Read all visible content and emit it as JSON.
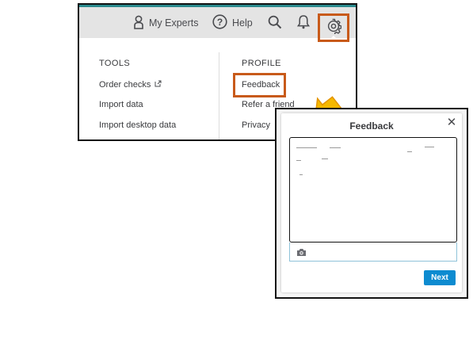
{
  "header": {
    "my_experts_label": "My Experts",
    "help_label": "Help",
    "icons": [
      "person-icon",
      "help-icon",
      "search-icon",
      "bell-icon",
      "gear-icon"
    ]
  },
  "settings_menu": {
    "tools": {
      "title": "TOOLS",
      "items": [
        "Order checks",
        "Import data",
        "Import desktop data"
      ]
    },
    "profile": {
      "title": "PROFILE",
      "items": [
        "Feedback",
        "Refer a friend",
        "Privacy"
      ]
    }
  },
  "feedback_dialog": {
    "title": "Feedback",
    "close_glyph": "✕",
    "next_label": "Next"
  },
  "colors": {
    "highlight_border": "#c85a1a",
    "arrow_fill": "#f5b800",
    "primary_button": "#0d8bd0",
    "header_bar": "#e4e4e4",
    "accent_teal": "#2a8a8e"
  }
}
